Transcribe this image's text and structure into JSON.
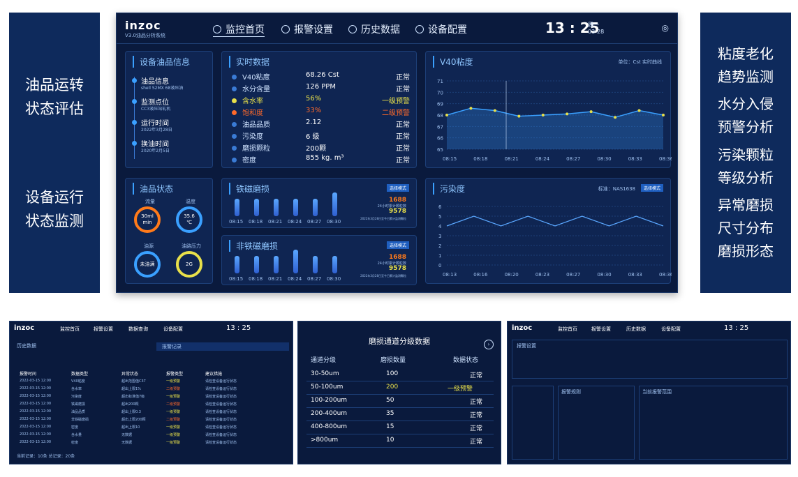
{
  "left_panel": {
    "items": [
      "油品运转\n状态评估",
      "设备运行\n状态监测"
    ]
  },
  "right_panel": {
    "items": [
      "粘度老化\n趋势监测",
      "水分入侵\n预警分析",
      "污染颗粒\n等级分析",
      "异常磨损\n尺寸分布\n磨损形态"
    ]
  },
  "header": {
    "logo": "inzoc",
    "logo_sub": "V3.0油品分析系统",
    "nav": [
      "监控首页",
      "报警设置",
      "历史数据",
      "设备配置"
    ],
    "time": "13 : 25",
    "weekday": "周一",
    "date": "03-28"
  },
  "device_info": {
    "title": "设备油品信息",
    "items": [
      {
        "label": "油品信息",
        "value": "shell S2MX 68液压油"
      },
      {
        "label": "监测点位",
        "value": "CC3液压站轧机"
      },
      {
        "label": "运行时间",
        "value": "2022年3月28日"
      },
      {
        "label": "换油时间",
        "value": "2020年2月5日"
      }
    ]
  },
  "realtime": {
    "title": "实时数据",
    "rows": [
      {
        "name": "V40粘度",
        "value": "68.26 Cst",
        "status": "正常",
        "color": "#ffffff",
        "status_color": "#ffffff",
        "dot": "#3a7bd5"
      },
      {
        "name": "水分含量",
        "value": "126 PPM",
        "status": "正常",
        "color": "#ffffff",
        "status_color": "#ffffff",
        "dot": "#3a7bd5"
      },
      {
        "name": "含水率",
        "value": "56%",
        "status": "一级预警",
        "color": "#e8e04a",
        "status_color": "#e8e04a",
        "dot": "#e8e04a"
      },
      {
        "name": "饱和度",
        "value": "33%",
        "status": "二级预警",
        "color": "#ff6a2a",
        "status_color": "#ff6a2a",
        "dot": "#ff6a2a"
      },
      {
        "name": "油品品质",
        "value": "2.12",
        "status": "正常",
        "color": "#ffffff",
        "status_color": "#ffffff",
        "dot": "#3a7bd5"
      },
      {
        "name": "污染度",
        "value": "6 级",
        "status": "正常",
        "color": "#ffffff",
        "status_color": "#ffffff",
        "dot": "#3a7bd5"
      },
      {
        "name": "磨损颗粒",
        "value": "200颗",
        "status": "正常",
        "color": "#ffffff",
        "status_color": "#ffffff",
        "dot": "#3a7bd5"
      },
      {
        "name": "密度",
        "value": "855 kg. m³",
        "status": "正常",
        "color": "#ffffff",
        "status_color": "#ffffff",
        "dot": "#3a7bd5"
      }
    ]
  },
  "viscosity": {
    "title": "V40粘度",
    "legend": "单位：Cst  实时曲线"
  },
  "oil_status": {
    "title": "油品状态",
    "gauges": [
      {
        "label": "流量",
        "value": "30ml\nmin"
      },
      {
        "label": "温度",
        "value": "35.6\n℃"
      },
      {
        "label": "油源",
        "value": "未油满"
      },
      {
        "label": "油路压力",
        "value": "2G"
      }
    ]
  },
  "ferro": {
    "title": "铁磁磨损",
    "count1": "1688",
    "count2": "9578",
    "badge": "选择模式",
    "note1": "24小时累计颗粒数",
    "note2": "2022年3月28日至今日累计监测颗粒"
  },
  "nonferro": {
    "title": "非铁磁磨损",
    "count1": "1688",
    "count2": "9578",
    "badge": "选择模式",
    "note1": "24小时累计颗粒数",
    "note2": "2022年3月28日至今日累计监测颗粒"
  },
  "pollution": {
    "title": "污染度",
    "legend": "标准：NAS1638",
    "badge": "选择模式"
  },
  "time_labels": [
    "08:15",
    "08:18",
    "08:21",
    "08:24",
    "08:27",
    "08:30",
    "08:33",
    "08:36"
  ],
  "wear_labels": [
    "08:15",
    "08:18",
    "08:21",
    "08:24",
    "08:27",
    "08:30"
  ],
  "chart_data": [
    {
      "type": "line",
      "title": "V40粘度",
      "x": [
        "08:15",
        "08:18",
        "08:21",
        "08:24",
        "08:27",
        "08:30",
        "08:33",
        "08:36"
      ],
      "series": [
        {
          "name": "实时曲线",
          "values": [
            68,
            68.6,
            68.4,
            67.9,
            68,
            68.1,
            68.3,
            67.8,
            68.4,
            68
          ]
        }
      ],
      "ylim": [
        65,
        71
      ]
    },
    {
      "type": "bar",
      "title": "铁磁磨损",
      "categories": [
        "08:15",
        "08:18",
        "08:21",
        "08:24",
        "08:27",
        "08:30"
      ],
      "values": [
        3,
        3,
        3,
        3,
        3,
        4
      ]
    },
    {
      "type": "bar",
      "title": "非铁磁磨损",
      "categories": [
        "08:15",
        "08:18",
        "08:21",
        "08:24",
        "08:27",
        "08:30"
      ],
      "values": [
        3,
        3,
        3,
        4,
        3,
        3
      ]
    },
    {
      "type": "line",
      "title": "污染度",
      "x": [
        "08:13",
        "08:16",
        "08:20",
        "08:23",
        "08:27",
        "08:30",
        "08:33",
        "08:36"
      ],
      "series": [
        {
          "values": [
            4,
            5,
            4,
            5,
            4,
            5,
            4,
            5,
            4
          ]
        }
      ],
      "ylim": [
        0,
        6
      ]
    }
  ],
  "thumb1": {
    "nav": [
      "监控首页",
      "报警设置",
      "数据查询",
      "设备配置"
    ],
    "time": "13 : 25",
    "section": "历史数据",
    "section2": "报警记录",
    "headers": [
      "报警时间",
      "数据类型",
      "异常状态",
      "报警类型",
      "建议措施"
    ],
    "rows": [
      [
        "2022-03-15 12:00",
        "V40粘度",
        "超出范围值C37",
        "一级预警",
        "请检查设备运行状态"
      ],
      [
        "2022-03-15 12:00",
        "含水率",
        "超出上限1%",
        "二级预警",
        "请检查设备运行状态"
      ],
      [
        "2022-03-15 12:00",
        "污染度",
        "超出标准值7级",
        "一级预警",
        "请检查设备运行状态"
      ],
      [
        "2022-03-15 12:00",
        "铁磁磨损",
        "超出200颗",
        "二级预警",
        "请检查设备运行状态"
      ],
      [
        "2022-03-15 12:00",
        "油品品质",
        "超出上限0.3",
        "一级预警",
        "请检查设备运行状态"
      ],
      [
        "2022-03-15 12:00",
        "非铁磁磨损",
        "超出上限200颗",
        "二级预警",
        "请检查设备运行状态"
      ],
      [
        "2022-03-15 12:00",
        "密度",
        "超出上限10",
        "一级预警",
        "请检查设备运行状态"
      ],
      [
        "2022-03-15 12:00",
        "含水量",
        "无数据",
        "一级预警",
        "请检查设备运行状态"
      ],
      [
        "2022-03-15 12:00",
        "密度",
        "无数据",
        "一级预警",
        "请检查设备运行状态"
      ]
    ],
    "footer": "当前记录：10条    总记录：20条"
  },
  "thumb2": {
    "title": "磨损通道分级数据",
    "headers": [
      "通道分级",
      "磨损数量",
      "数据状态"
    ],
    "rows": [
      [
        "30-50um",
        "100",
        "正常"
      ],
      [
        "50-100um",
        "200",
        "一级预警"
      ],
      [
        "100-200um",
        "50",
        "正常"
      ],
      [
        "200-400um",
        "35",
        "正常"
      ],
      [
        "400-800um",
        "15",
        "正常"
      ],
      [
        ">800um",
        "10",
        "正常"
      ]
    ]
  },
  "thumb3": {
    "nav": [
      "监控首页",
      "报警设置",
      "历史数据",
      "设备配置"
    ],
    "time": "13 : 25",
    "section": "报警设置",
    "section2": "报警规则",
    "section3": "当前报警范围"
  }
}
